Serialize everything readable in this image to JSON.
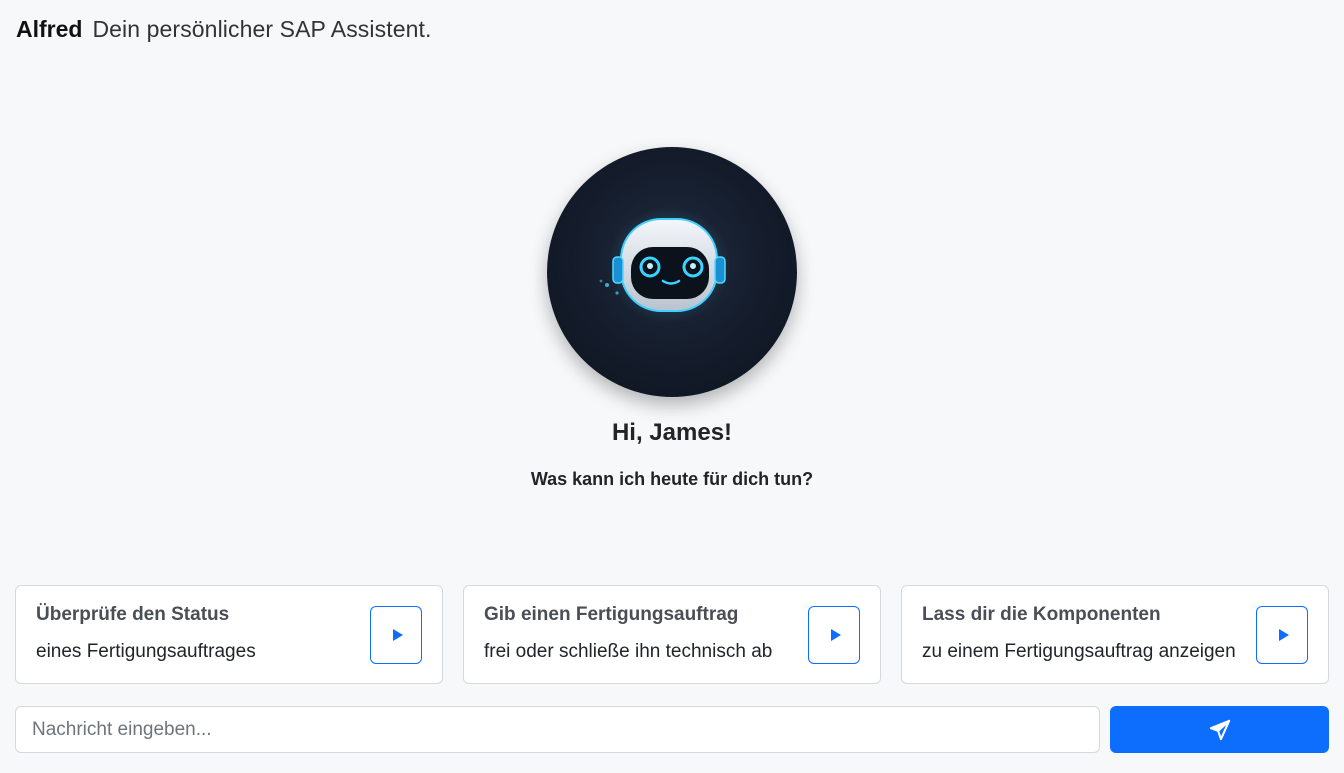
{
  "header": {
    "brand": "Alfred",
    "tagline": "Dein persönlicher SAP Assistent."
  },
  "welcome": {
    "greeting": "Hi, James!",
    "question": "Was kann ich heute für dich tun?",
    "avatar_icon": "robot-avatar-icon"
  },
  "suggestions": [
    {
      "title": "Überprüfe den Status",
      "subtitle": "eines Fertigungsauftrages",
      "icon": "play-icon"
    },
    {
      "title": "Gib einen Fertigungsauftrag",
      "subtitle": "frei oder schließe ihn technisch ab",
      "icon": "play-icon"
    },
    {
      "title": "Lass dir die Komponenten",
      "subtitle": "zu einem Fertigungsauftrag anzeigen",
      "icon": "play-icon"
    }
  ],
  "composer": {
    "placeholder": "Nachricht eingeben...",
    "value": "",
    "send_icon": "send-icon"
  },
  "colors": {
    "background": "#f7f8fa",
    "accent": "#0d6efd",
    "avatar_bg": "#141c2b",
    "robot_glow": "#2bc7ff"
  }
}
